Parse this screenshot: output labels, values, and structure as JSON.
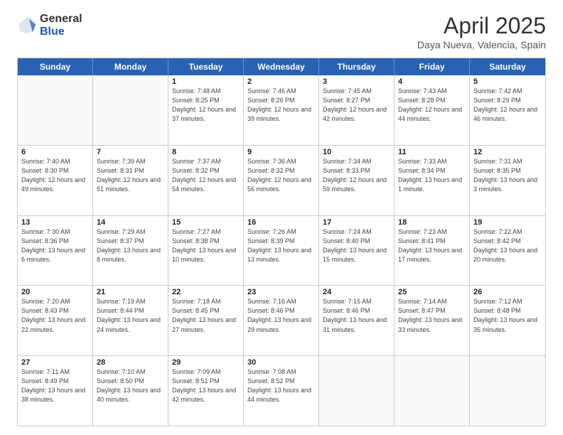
{
  "header": {
    "logo_general": "General",
    "logo_blue": "Blue",
    "title": "April 2025",
    "subtitle": "Daya Nueva, Valencia, Spain"
  },
  "days_of_week": [
    "Sunday",
    "Monday",
    "Tuesday",
    "Wednesday",
    "Thursday",
    "Friday",
    "Saturday"
  ],
  "weeks": [
    [
      {
        "day": null,
        "sunrise": null,
        "sunset": null,
        "daylight": null
      },
      {
        "day": null,
        "sunrise": null,
        "sunset": null,
        "daylight": null
      },
      {
        "day": "1",
        "sunrise": "Sunrise: 7:48 AM",
        "sunset": "Sunset: 8:25 PM",
        "daylight": "Daylight: 12 hours and 37 minutes."
      },
      {
        "day": "2",
        "sunrise": "Sunrise: 7:46 AM",
        "sunset": "Sunset: 8:26 PM",
        "daylight": "Daylight: 12 hours and 39 minutes."
      },
      {
        "day": "3",
        "sunrise": "Sunrise: 7:45 AM",
        "sunset": "Sunset: 8:27 PM",
        "daylight": "Daylight: 12 hours and 42 minutes."
      },
      {
        "day": "4",
        "sunrise": "Sunrise: 7:43 AM",
        "sunset": "Sunset: 8:28 PM",
        "daylight": "Daylight: 12 hours and 44 minutes."
      },
      {
        "day": "5",
        "sunrise": "Sunrise: 7:42 AM",
        "sunset": "Sunset: 8:29 PM",
        "daylight": "Daylight: 12 hours and 46 minutes."
      }
    ],
    [
      {
        "day": "6",
        "sunrise": "Sunrise: 7:40 AM",
        "sunset": "Sunset: 8:30 PM",
        "daylight": "Daylight: 12 hours and 49 minutes."
      },
      {
        "day": "7",
        "sunrise": "Sunrise: 7:39 AM",
        "sunset": "Sunset: 8:31 PM",
        "daylight": "Daylight: 12 hours and 51 minutes."
      },
      {
        "day": "8",
        "sunrise": "Sunrise: 7:37 AM",
        "sunset": "Sunset: 8:32 PM",
        "daylight": "Daylight: 12 hours and 54 minutes."
      },
      {
        "day": "9",
        "sunrise": "Sunrise: 7:36 AM",
        "sunset": "Sunset: 8:32 PM",
        "daylight": "Daylight: 12 hours and 56 minutes."
      },
      {
        "day": "10",
        "sunrise": "Sunrise: 7:34 AM",
        "sunset": "Sunset: 8:33 PM",
        "daylight": "Daylight: 12 hours and 59 minutes."
      },
      {
        "day": "11",
        "sunrise": "Sunrise: 7:33 AM",
        "sunset": "Sunset: 8:34 PM",
        "daylight": "Daylight: 13 hours and 1 minute."
      },
      {
        "day": "12",
        "sunrise": "Sunrise: 7:31 AM",
        "sunset": "Sunset: 8:35 PM",
        "daylight": "Daylight: 13 hours and 3 minutes."
      }
    ],
    [
      {
        "day": "13",
        "sunrise": "Sunrise: 7:30 AM",
        "sunset": "Sunset: 8:36 PM",
        "daylight": "Daylight: 13 hours and 6 minutes."
      },
      {
        "day": "14",
        "sunrise": "Sunrise: 7:29 AM",
        "sunset": "Sunset: 8:37 PM",
        "daylight": "Daylight: 13 hours and 8 minutes."
      },
      {
        "day": "15",
        "sunrise": "Sunrise: 7:27 AM",
        "sunset": "Sunset: 8:38 PM",
        "daylight": "Daylight: 13 hours and 10 minutes."
      },
      {
        "day": "16",
        "sunrise": "Sunrise: 7:26 AM",
        "sunset": "Sunset: 8:39 PM",
        "daylight": "Daylight: 13 hours and 13 minutes."
      },
      {
        "day": "17",
        "sunrise": "Sunrise: 7:24 AM",
        "sunset": "Sunset: 8:40 PM",
        "daylight": "Daylight: 13 hours and 15 minutes."
      },
      {
        "day": "18",
        "sunrise": "Sunrise: 7:23 AM",
        "sunset": "Sunset: 8:41 PM",
        "daylight": "Daylight: 13 hours and 17 minutes."
      },
      {
        "day": "19",
        "sunrise": "Sunrise: 7:22 AM",
        "sunset": "Sunset: 8:42 PM",
        "daylight": "Daylight: 13 hours and 20 minutes."
      }
    ],
    [
      {
        "day": "20",
        "sunrise": "Sunrise: 7:20 AM",
        "sunset": "Sunset: 8:43 PM",
        "daylight": "Daylight: 13 hours and 22 minutes."
      },
      {
        "day": "21",
        "sunrise": "Sunrise: 7:19 AM",
        "sunset": "Sunset: 8:44 PM",
        "daylight": "Daylight: 13 hours and 24 minutes."
      },
      {
        "day": "22",
        "sunrise": "Sunrise: 7:18 AM",
        "sunset": "Sunset: 8:45 PM",
        "daylight": "Daylight: 13 hours and 27 minutes."
      },
      {
        "day": "23",
        "sunrise": "Sunrise: 7:16 AM",
        "sunset": "Sunset: 8:46 PM",
        "daylight": "Daylight: 13 hours and 29 minutes."
      },
      {
        "day": "24",
        "sunrise": "Sunrise: 7:15 AM",
        "sunset": "Sunset: 8:46 PM",
        "daylight": "Daylight: 13 hours and 31 minutes."
      },
      {
        "day": "25",
        "sunrise": "Sunrise: 7:14 AM",
        "sunset": "Sunset: 8:47 PM",
        "daylight": "Daylight: 13 hours and 33 minutes."
      },
      {
        "day": "26",
        "sunrise": "Sunrise: 7:12 AM",
        "sunset": "Sunset: 8:48 PM",
        "daylight": "Daylight: 13 hours and 35 minutes."
      }
    ],
    [
      {
        "day": "27",
        "sunrise": "Sunrise: 7:11 AM",
        "sunset": "Sunset: 8:49 PM",
        "daylight": "Daylight: 13 hours and 38 minutes."
      },
      {
        "day": "28",
        "sunrise": "Sunrise: 7:10 AM",
        "sunset": "Sunset: 8:50 PM",
        "daylight": "Daylight: 13 hours and 40 minutes."
      },
      {
        "day": "29",
        "sunrise": "Sunrise: 7:09 AM",
        "sunset": "Sunset: 8:51 PM",
        "daylight": "Daylight: 13 hours and 42 minutes."
      },
      {
        "day": "30",
        "sunrise": "Sunrise: 7:08 AM",
        "sunset": "Sunset: 8:52 PM",
        "daylight": "Daylight: 13 hours and 44 minutes."
      },
      {
        "day": null,
        "sunrise": null,
        "sunset": null,
        "daylight": null
      },
      {
        "day": null,
        "sunrise": null,
        "sunset": null,
        "daylight": null
      },
      {
        "day": null,
        "sunrise": null,
        "sunset": null,
        "daylight": null
      }
    ]
  ]
}
